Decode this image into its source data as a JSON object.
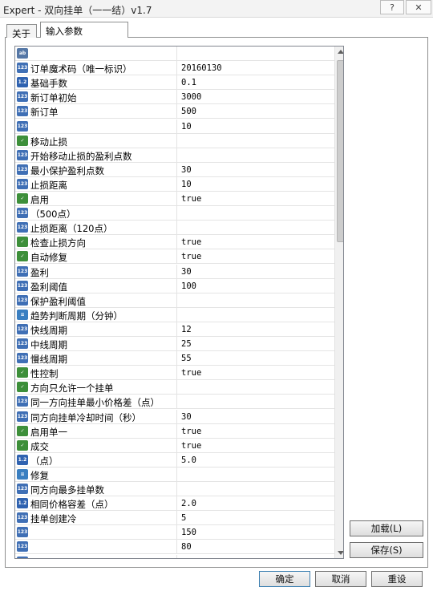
{
  "window": {
    "title": "Expert - 双向挂单（一一结）v1.7",
    "help_label": "?",
    "close_label": "✕"
  },
  "tabs": [
    {
      "label": "关于"
    },
    {
      "label": "输入参数"
    }
  ],
  "grid": {
    "rows": [
      {
        "name": "",
        "value": "",
        "icon": "text-icon"
      },
      {
        "name": "订单魔术码（唯一标识）",
        "value": "20160130",
        "icon": "number-icon"
      },
      {
        "name": "基础手数",
        "value": "0.1",
        "icon": "double-icon"
      },
      {
        "name": "新订单初始",
        "value": "3000",
        "icon": "number-icon"
      },
      {
        "name": "新订单",
        "value": "500",
        "icon": "number-icon"
      },
      {
        "name": "",
        "value": "10",
        "icon": "number-icon"
      },
      {
        "name": "移动止损",
        "value": "",
        "icon": "bool-icon"
      },
      {
        "name": "开始移动止损的盈利点数",
        "value": "",
        "icon": "number-icon"
      },
      {
        "name": "最小保护盈利点数",
        "value": "30",
        "icon": "number-icon"
      },
      {
        "name": "止损距离",
        "value": "10",
        "icon": "number-icon"
      },
      {
        "name": "启用",
        "value": "true",
        "icon": "bool-icon"
      },
      {
        "name": "（500点）",
        "value": "",
        "icon": "number-icon"
      },
      {
        "name": "止损距离（120点）",
        "value": "",
        "icon": "number-icon"
      },
      {
        "name": "检查止损方向",
        "value": "true",
        "icon": "bool-icon"
      },
      {
        "name": "自动修复",
        "value": "true",
        "icon": "bool-icon"
      },
      {
        "name": "盈利",
        "value": "30",
        "icon": "number-icon"
      },
      {
        "name": "盈利阈值",
        "value": "100",
        "icon": "number-icon"
      },
      {
        "name": "保护盈利阈值",
        "value": "",
        "icon": "number-icon"
      },
      {
        "name": "趋势判断周期（分钟）",
        "value": "",
        "icon": "enum-icon"
      },
      {
        "name": "快线周期",
        "value": "12",
        "icon": "number-icon"
      },
      {
        "name": "中线周期",
        "value": "25",
        "icon": "number-icon"
      },
      {
        "name": "慢线周期",
        "value": "55",
        "icon": "number-icon"
      },
      {
        "name": "性控制",
        "value": "true",
        "icon": "bool-icon"
      },
      {
        "name": "方向只允许一个挂单",
        "value": "",
        "icon": "bool-icon"
      },
      {
        "name": "同一方向挂单最小价格差（点）",
        "value": "",
        "icon": "number-icon"
      },
      {
        "name": "同方向挂单冷却时间（秒）",
        "value": "30",
        "icon": "number-icon"
      },
      {
        "name": "启用单一",
        "value": "true",
        "icon": "bool-icon"
      },
      {
        "name": "成交",
        "value": "true",
        "icon": "bool-icon"
      },
      {
        "name": "（点）",
        "value": "5.0",
        "icon": "double-icon"
      },
      {
        "name": "修复",
        "value": "",
        "icon": "enum-icon"
      },
      {
        "name": "同方向最多挂单数",
        "value": "",
        "icon": "number-icon"
      },
      {
        "name": "相同价格容差（点）",
        "value": "2.0",
        "icon": "double-icon"
      },
      {
        "name": "挂单创建冷",
        "value": "5",
        "icon": "number-icon"
      },
      {
        "name": "",
        "value": "150",
        "icon": "number-icon"
      },
      {
        "name": "",
        "value": "80",
        "icon": "number-icon"
      },
      {
        "name": "",
        "value": "",
        "icon": "number-icon"
      }
    ]
  },
  "buttons": {
    "load": "加载(L)",
    "save": "保存(S)",
    "ok": "确定",
    "cancel": "取消",
    "reset": "重设"
  }
}
